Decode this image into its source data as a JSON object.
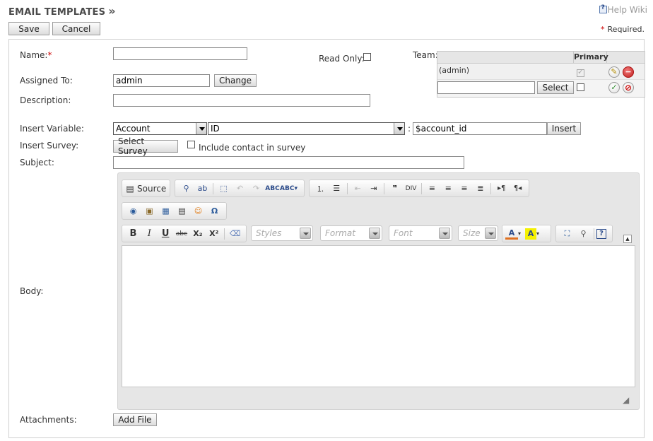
{
  "header": {
    "title": "EMAIL TEMPLATES",
    "arrows": "»",
    "help_label": "Help Wiki"
  },
  "toolbar": {
    "save_label": "Save",
    "cancel_label": "Cancel"
  },
  "required_note": "Required.",
  "form": {
    "name_label": "Name:",
    "name_value": "",
    "read_only_label": "Read Only:",
    "assigned_label": "Assigned To:",
    "assigned_value": "admin",
    "change_label": "Change",
    "description_label": "Description:",
    "description_value": "",
    "team_label": "Team:",
    "insert_variable_label": "Insert Variable:",
    "module_select": "Account",
    "field_select": "ID",
    "variable_sep": ":",
    "variable_value": "$account_id",
    "insert_label": "Insert",
    "insert_survey_label": "Insert Survey:",
    "select_survey_label": "Select Survey",
    "include_contact_label": "Include contact in survey",
    "subject_label": "Subject:",
    "subject_value": "",
    "body_label": "Body:",
    "attachments_label": "Attachments:",
    "add_file_label": "Add File"
  },
  "team": {
    "primary_header": "Primary",
    "row_team": "(admin)",
    "select_label": "Select",
    "new_team_value": ""
  },
  "editor": {
    "source_label": "Source",
    "combos": {
      "styles": "Styles",
      "format": "Format",
      "font": "Font",
      "size": "Size"
    },
    "bold": "B",
    "italic": "I",
    "underline": "U",
    "strike": "abc",
    "subscript": "X₂",
    "superscript": "X²"
  }
}
